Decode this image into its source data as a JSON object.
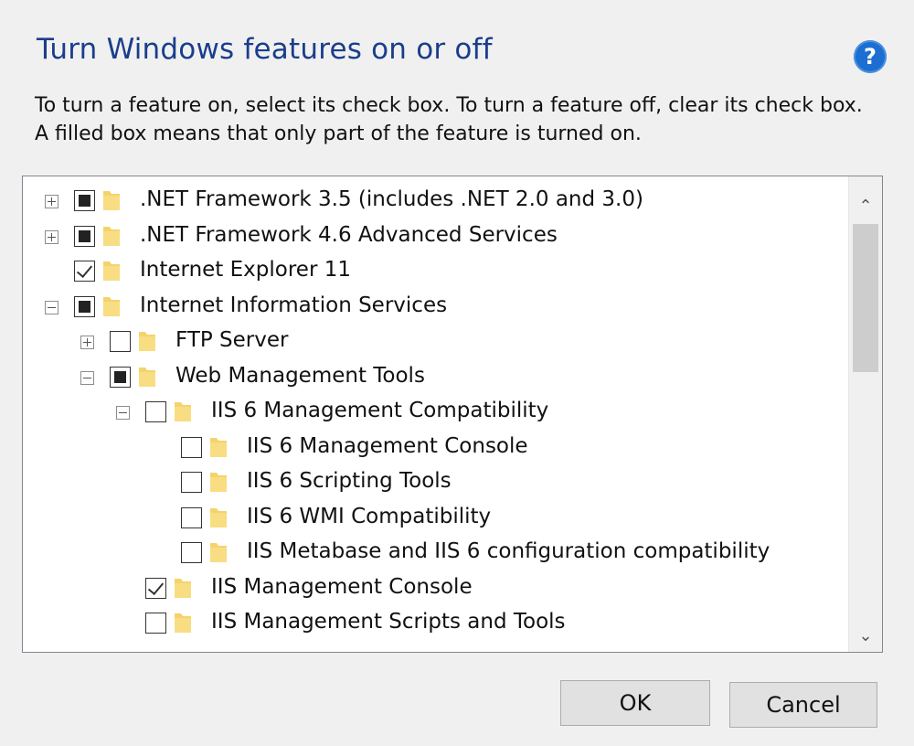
{
  "dialog": {
    "title": "Turn Windows features on or off",
    "help_glyph": "?",
    "description": "To turn a feature on, select its check box. To turn a feature off, clear its check box. A filled box means that only part of the feature is turned on."
  },
  "tree": {
    "items": [
      {
        "label": ".NET Framework 3.5 (includes .NET 2.0 and 3.0)",
        "expander": "plus",
        "state": "partial",
        "level": 0
      },
      {
        "label": ".NET Framework 4.6 Advanced Services",
        "expander": "plus",
        "state": "partial",
        "level": 0
      },
      {
        "label": "Internet Explorer 11",
        "expander": "none",
        "state": "checked",
        "level": 0
      },
      {
        "label": "Internet Information Services",
        "expander": "minus",
        "state": "partial",
        "level": 0
      },
      {
        "label": "FTP Server",
        "expander": "plus",
        "state": "unchecked",
        "level": 1
      },
      {
        "label": "Web Management Tools",
        "expander": "minus",
        "state": "partial",
        "level": 1
      },
      {
        "label": "IIS 6 Management Compatibility",
        "expander": "minus",
        "state": "unchecked",
        "level": 2
      },
      {
        "label": "IIS 6 Management Console",
        "expander": "none",
        "state": "unchecked",
        "level": 3
      },
      {
        "label": "IIS 6 Scripting Tools",
        "expander": "none",
        "state": "unchecked",
        "level": 3
      },
      {
        "label": "IIS 6 WMI Compatibility",
        "expander": "none",
        "state": "unchecked",
        "level": 3
      },
      {
        "label": "IIS Metabase and IIS 6 configuration compatibility",
        "expander": "none",
        "state": "unchecked",
        "level": 3
      },
      {
        "label": "IIS Management Console",
        "expander": "none",
        "state": "checked",
        "level": 2
      },
      {
        "label": "IIS Management Scripts and Tools",
        "expander": "none",
        "state": "unchecked",
        "level": 2
      }
    ]
  },
  "scrollbar": {
    "up_glyph": "⌃",
    "down_glyph": "⌄"
  },
  "buttons": {
    "ok_label": "OK",
    "cancel_label": "Cancel"
  },
  "colors": {
    "title": "#1a3e8c",
    "help_bg": "#1c6fd0",
    "folder": "#f5d36b",
    "dialog_bg": "#f0f0f0"
  }
}
